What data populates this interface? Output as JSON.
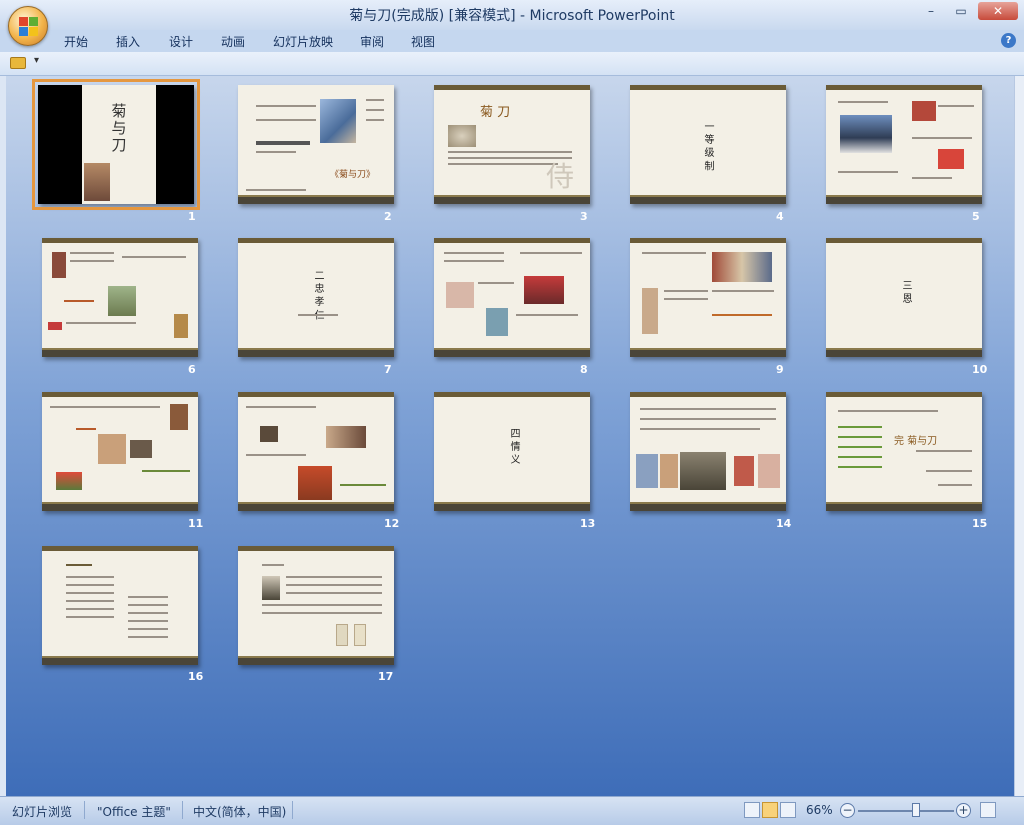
{
  "window": {
    "title": "菊与刀(完成版) [兼容模式] - Microsoft PowerPoint",
    "minimize": "–",
    "restore": "▭",
    "close": "✕"
  },
  "ribbon": {
    "tabs": [
      "开始",
      "插入",
      "设计",
      "动画",
      "幻灯片放映",
      "审阅",
      "视图"
    ],
    "help_icon": "?"
  },
  "quick_access": {
    "customize_icon": "▾"
  },
  "slides": [
    {
      "number": "1",
      "title": "菊 与 刀",
      "selected": true
    },
    {
      "number": "2",
      "title": "《菊与刀》"
    },
    {
      "number": "3",
      "title": "菊 刀"
    },
    {
      "number": "4",
      "title": "一 等 级 制"
    },
    {
      "number": "5",
      "title": ""
    },
    {
      "number": "6",
      "title": ""
    },
    {
      "number": "7",
      "title": "二 忠 孝 仁"
    },
    {
      "number": "8",
      "title": ""
    },
    {
      "number": "9",
      "title": ""
    },
    {
      "number": "10",
      "title": "三 恩"
    },
    {
      "number": "11",
      "title": ""
    },
    {
      "number": "12",
      "title": ""
    },
    {
      "number": "13",
      "title": "四 情 义"
    },
    {
      "number": "14",
      "title": ""
    },
    {
      "number": "15",
      "title": "完 菊与刀"
    },
    {
      "number": "16",
      "title": ""
    },
    {
      "number": "17",
      "title": ""
    }
  ],
  "statusbar": {
    "view_mode": "幻灯片浏览",
    "theme": "\"Office 主题\"",
    "language": "中文(简体，中国)",
    "zoom": "66%",
    "zoom_minus": "−",
    "zoom_plus": "+"
  },
  "colors": {
    "slide_bar_top": "#6a5b37",
    "slide_bar_bottom": "#4a4538",
    "selection": "#e5973f"
  }
}
